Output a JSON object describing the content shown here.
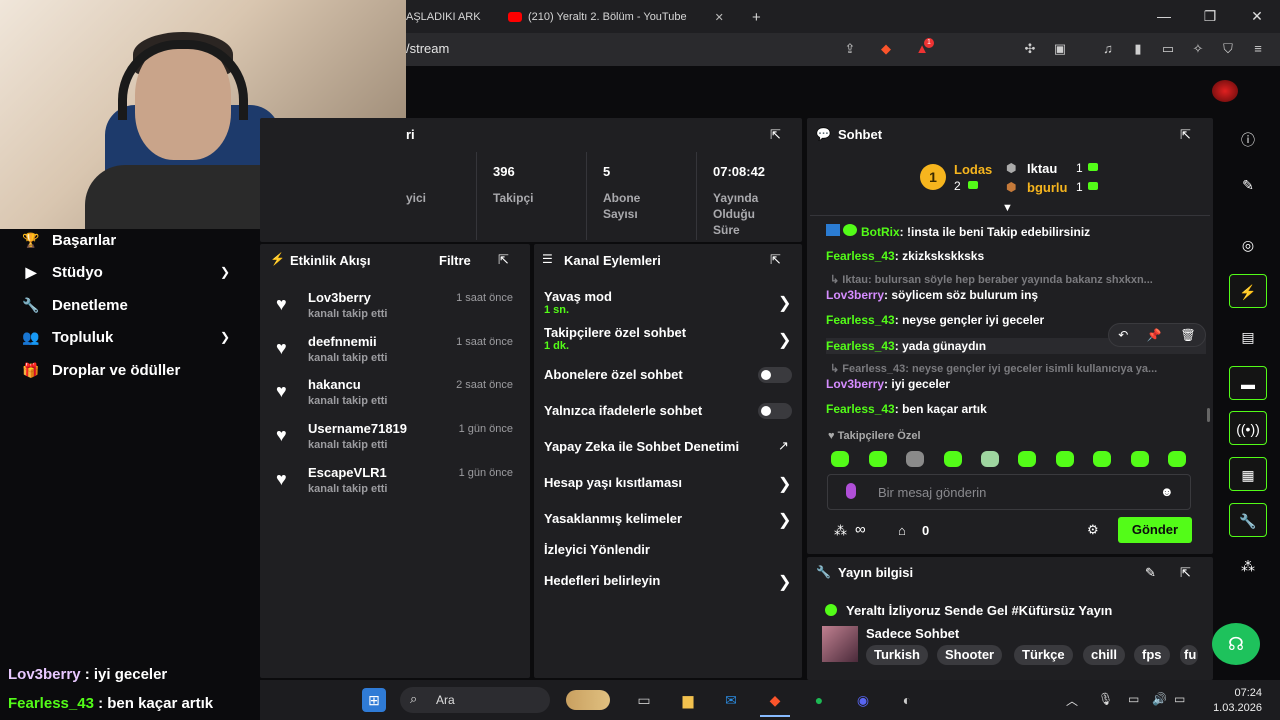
{
  "browser": {
    "tabs": [
      {
        "title": "AŞLADIKI ARK"
      },
      {
        "title": "(210) Yeraltı 2. Bölüm - YouTube"
      }
    ],
    "new_tab": "+",
    "url": "/stream",
    "badge_count": "1"
  },
  "sidebar": {
    "items": [
      {
        "label": "Başarılar"
      },
      {
        "label": "Stüdyo"
      },
      {
        "label": "Denetleme"
      },
      {
        "label": "Topluluk"
      },
      {
        "label": "Droplar ve ödüller"
      }
    ]
  },
  "stats_panel": {
    "title_fragment": "ri",
    "stats": [
      {
        "value": "",
        "label": "yici"
      },
      {
        "value": "396",
        "label": "Takipçi"
      },
      {
        "value": "5",
        "label": "Abone Sayısı"
      },
      {
        "value": "07:08:42",
        "label": "Yayında Olduğu Süre"
      }
    ]
  },
  "activity_feed": {
    "title": "Etkinlik Akışı",
    "filter_label": "Filtre",
    "items": [
      {
        "name": "Lov3berry",
        "sub": "kanalı takip etti",
        "time": "1 saat önce"
      },
      {
        "name": "deefnnemii",
        "sub": "kanalı takip etti",
        "time": "1 saat önce"
      },
      {
        "name": "hakancu",
        "sub": "kanalı takip etti",
        "time": "2 saat önce"
      },
      {
        "name": "Username71819",
        "sub": "kanalı takip etti",
        "time": "1 gün önce"
      },
      {
        "name": "EscapeVLR1",
        "sub": "kanalı takip etti",
        "time": "1 gün önce"
      }
    ]
  },
  "channel_actions": {
    "title": "Kanal Eylemleri",
    "items": [
      {
        "label": "Yavaş mod",
        "sub": "1 sn."
      },
      {
        "label": "Takipçilere özel sohbet",
        "sub": "1 dk."
      },
      {
        "label": "Abonelere özel sohbet",
        "toggle": false
      },
      {
        "label": "Yalnızca ifadelerle sohbet",
        "toggle": false
      },
      {
        "label": "Yapay Zeka ile Sohbet Denetimi"
      },
      {
        "label": "Hesap yaşı kısıtlaması"
      },
      {
        "label": "Yasaklanmış kelimeler"
      },
      {
        "label": "İzleyici Yönlendir"
      },
      {
        "label": "Hedefleri belirleyin"
      }
    ]
  },
  "chat": {
    "title": "Sohbet",
    "leaders": {
      "first": {
        "name": "Lodas",
        "rank": "1",
        "count": "2"
      },
      "second": {
        "name": "Iktau",
        "count": "1"
      },
      "third": {
        "name": "bgurlu",
        "count": "1"
      }
    },
    "messages": [
      {
        "nick": "BotRix",
        "text": "!insta ile beni Takip edebilirsiniz"
      },
      {
        "nick": "Fearless_43",
        "text": "zkizkskskksks"
      },
      {
        "reply": "Iktau: bulursan söyle hep beraber yayında bakanz shxkxn..."
      },
      {
        "nick": "Lov3berry",
        "text": "söylicem söz bulurum inş"
      },
      {
        "nick": "Fearless_43",
        "text": "neyse gençler iyi geceler"
      },
      {
        "nick": "Fearless_43",
        "text": "yada günaydın"
      },
      {
        "reply": "Fearless_43: neyse gençler iyi geceler isimli kullanıcıya ya..."
      },
      {
        "nick": "Lov3berry",
        "text": "iyi geceler"
      },
      {
        "nick": "Fearless_43",
        "text": "ben kaçar artık"
      }
    ],
    "emote_section": "Takipçilere Özel",
    "input_placeholder": "Bir mesaj gönderin",
    "viewers": "∞",
    "points": "0",
    "send_label": "Gönder"
  },
  "stream_info": {
    "title": "Yayın bilgisi",
    "stream_title": "Yeraltı İzliyoruz Sende Gel #Küfürsüz Yayın",
    "category": "Sadece Sohbet",
    "tags": [
      "Turkish",
      "Shooter",
      "Türkçe",
      "chill",
      "fps",
      "fu"
    ]
  },
  "overlay_chat": [
    {
      "nick": "Lov3berry",
      "text": " : iyi geceler"
    },
    {
      "nick": "Fearless_43",
      "text": " : ben kaçar artık"
    }
  ],
  "taskbar": {
    "search_label": "Ara",
    "time": "07:24",
    "date": "1.03.2026"
  },
  "colors": {
    "accent": "#53fc18",
    "panel": "#1f1f22",
    "background": "#0b0b0d"
  }
}
